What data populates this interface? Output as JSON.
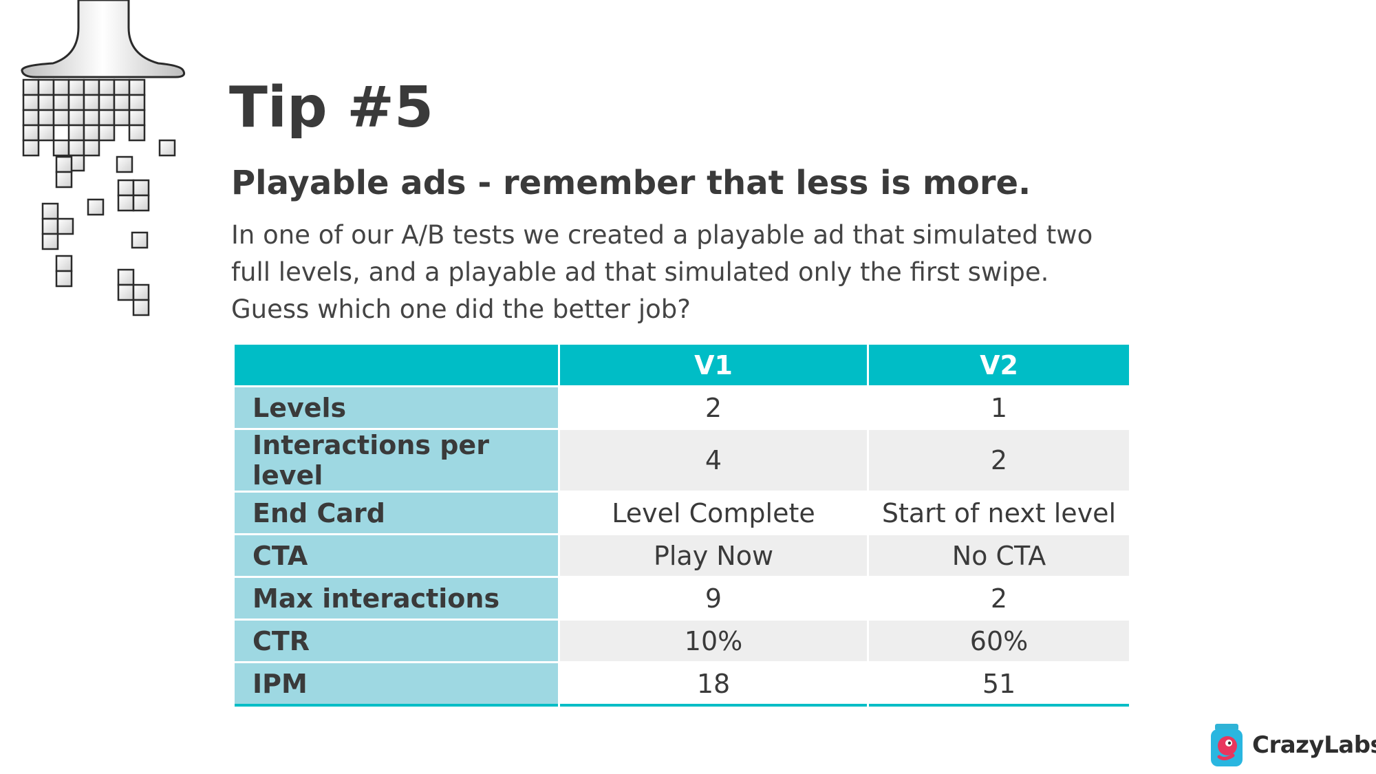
{
  "slide": {
    "title": "Tip #5",
    "subtitle": "Playable ads - remember that less is more.",
    "body_lines": [
      "In one of our A/B tests we created a playable ad that simulated two",
      "full levels, and a playable ad that simulated only the first swipe.",
      "Guess which one did the better job?"
    ]
  },
  "table": {
    "headers": [
      "",
      "V1",
      "V2"
    ],
    "rows": [
      {
        "label": "Levels",
        "v1": "2",
        "v2": "1"
      },
      {
        "label": "Interactions per level",
        "v1": "4",
        "v2": "2"
      },
      {
        "label": "End Card",
        "v1": "Level Complete",
        "v2": "Start of next level"
      },
      {
        "label": "CTA",
        "v1": "Play Now",
        "v2": "No CTA"
      },
      {
        "label": "Max interactions",
        "v1": "9",
        "v2": "2"
      },
      {
        "label": "CTR",
        "v1": "10%",
        "v2": "60%"
      },
      {
        "label": "IPM",
        "v1": "18",
        "v2": "51"
      }
    ]
  },
  "logo": {
    "text": "CrazyLabs",
    "icon": "crazylabs-jar-icon"
  },
  "decoration": {
    "icon": "paintbrush-pixels-icon"
  },
  "colors": {
    "accent": "#00bdc6",
    "label_bg": "#9ed8e2",
    "stripe": "#eeeeee",
    "text": "#3a3a3a"
  }
}
